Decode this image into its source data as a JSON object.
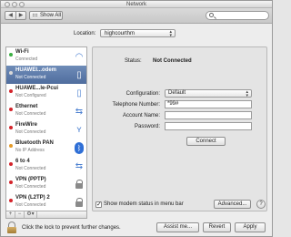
{
  "window": {
    "title": "Network"
  },
  "toolbar": {
    "back_glyph": "◀",
    "forward_glyph": "▶",
    "show_all_label": "Show All",
    "search_placeholder": ""
  },
  "location": {
    "label": "Location:",
    "value": "highcourthm"
  },
  "services": [
    {
      "name": "Wi-Fi",
      "status": "Connected",
      "dot_color": "#3cb043",
      "icon": "wifi-icon",
      "selected": false
    },
    {
      "name": "HUAWEI...odem",
      "status": "Not Connected",
      "dot_color": "#d8d8d8",
      "icon": "phone-icon",
      "selected": true
    },
    {
      "name": "HUAWE...le-Pcui",
      "status": "Not Configured",
      "dot_color": "#d4242b",
      "icon": "phone-icon",
      "selected": false
    },
    {
      "name": "Ethernet",
      "status": "Not Connected",
      "dot_color": "#d4242b",
      "icon": "ethernet-icon",
      "selected": false
    },
    {
      "name": "FireWire",
      "status": "Not Connected",
      "dot_color": "#d4242b",
      "icon": "firewire-icon",
      "selected": false
    },
    {
      "name": "Bluetooth PAN",
      "status": "No IP Address",
      "dot_color": "#e49a28",
      "icon": "bluetooth-icon",
      "selected": false
    },
    {
      "name": "6 to 4",
      "status": "Not Connected",
      "dot_color": "#d4242b",
      "icon": "tunnel-icon",
      "selected": false
    },
    {
      "name": "VPN (PPTP)",
      "status": "Not Connected",
      "dot_color": "#d4242b",
      "icon": "lock-icon",
      "selected": false
    },
    {
      "name": "VPN (L2TP) 2",
      "status": "Not Connected",
      "dot_color": "#d4242b",
      "icon": "lock-icon",
      "selected": false
    }
  ],
  "sidebar_footer": {
    "add": "+",
    "remove": "−",
    "gear": "⚙▾"
  },
  "detail": {
    "status_label": "Status:",
    "status_value": "Not Connected",
    "configuration_label": "Configuration:",
    "configuration_value": "Default",
    "phone_label": "Telephone Number:",
    "phone_value": "*99#",
    "account_label": "Account Name:",
    "account_value": "",
    "password_label": "Password:",
    "password_value": "",
    "connect_label": "Connect",
    "modem_checkbox_label": "Show modem status in menu bar",
    "modem_checked": true,
    "advanced_label": "Advanced...",
    "help_label": "?"
  },
  "bottom": {
    "lock_text": "Click the lock to prevent further changes.",
    "assist_label": "Assist me...",
    "revert_label": "Revert",
    "apply_label": "Apply"
  },
  "colors": {
    "selection": "#5a78a9",
    "connected": "#3cb043",
    "disconnected": "#d4242b",
    "warning": "#e49a28"
  }
}
